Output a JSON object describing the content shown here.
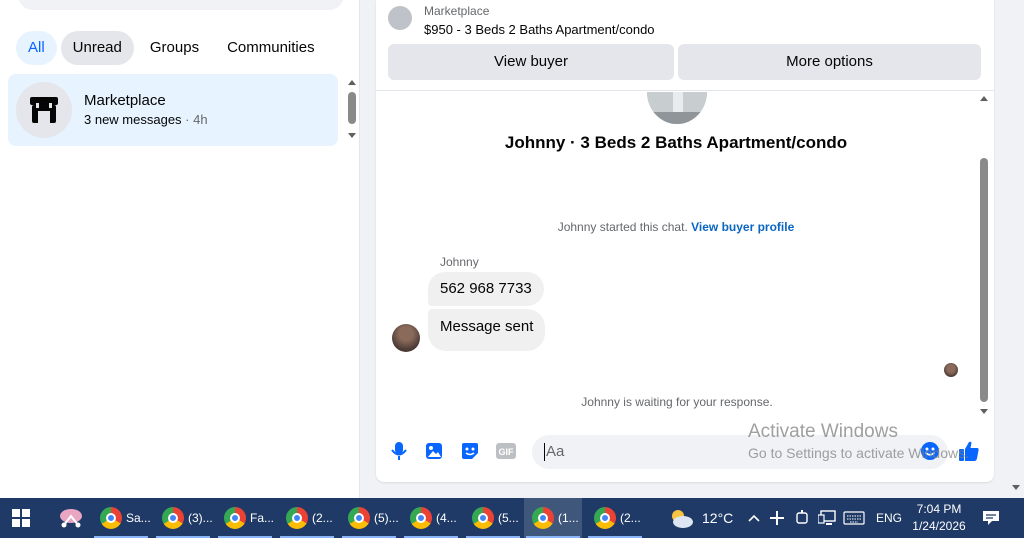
{
  "sidebar": {
    "filters": [
      "All",
      "Unread",
      "Groups",
      "Communities"
    ],
    "conversation": {
      "title": "Marketplace",
      "snippet": "3 new messages",
      "time": "4h"
    }
  },
  "chat": {
    "header": {
      "source": "Marketplace",
      "listing": "$950 - 3 Beds 2 Baths Apartment/condo",
      "view_buyer": "View buyer",
      "more_options": "More options"
    },
    "title": "Johnny · 3 Beds 2 Baths Apartment/condo",
    "system_started": "Johnny started this chat.",
    "system_link": "View buyer profile",
    "sender_name": "Johnny",
    "messages": [
      "562 968 7733",
      "Message sent"
    ],
    "waiting": "Johnny is waiting for your response.",
    "composer_placeholder": "Aa"
  },
  "watermark": {
    "line1": "Activate Windows",
    "line2": "Go to Settings to activate Windows."
  },
  "taskbar": {
    "apps": [
      {
        "label": "Sa...",
        "icon": "chrome-icon"
      },
      {
        "label": "(3)...",
        "icon": "chrome-icon"
      },
      {
        "label": "Fa...",
        "icon": "chrome-icon"
      },
      {
        "label": "(2...",
        "icon": "chrome-icon"
      },
      {
        "label": "(5)...",
        "icon": "chrome-icon"
      },
      {
        "label": "(4...",
        "icon": "chrome-icon"
      },
      {
        "label": "(5...",
        "icon": "chrome-icon"
      },
      {
        "label": "(1...",
        "icon": "chrome-icon"
      },
      {
        "label": "(2...",
        "icon": "chrome-icon"
      }
    ],
    "temperature": "12°C",
    "language": "ENG",
    "time": "7:04 PM",
    "date": "1/24/2026"
  },
  "colors": {
    "accent": "#0866ff",
    "link": "#0a66c2",
    "taskbar": "#1f3a66"
  }
}
